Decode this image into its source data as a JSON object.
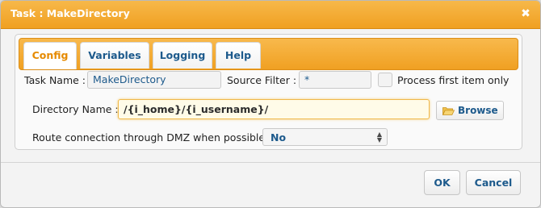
{
  "window": {
    "title": "Task : MakeDirectory"
  },
  "tabs": [
    {
      "label": "Config"
    },
    {
      "label": "Variables"
    },
    {
      "label": "Logging"
    },
    {
      "label": "Help"
    }
  ],
  "form": {
    "task_name_label": "Task Name :",
    "task_name_value": "MakeDirectory",
    "source_filter_label": "Source Filter :",
    "source_filter_value": "*",
    "process_first_label": "Process first item only",
    "directory_name_label": "Directory Name :",
    "directory_name_value": "/{i_home}/{i_username}/",
    "browse_label": "Browse",
    "dmz_label": "Route connection through DMZ when possible :",
    "dmz_value": "No"
  },
  "footer": {
    "ok_label": "OK",
    "cancel_label": "Cancel"
  },
  "colors": {
    "accent": "#f0a021",
    "link_text": "#1d5a8c",
    "active_tab": "#e68a00"
  }
}
